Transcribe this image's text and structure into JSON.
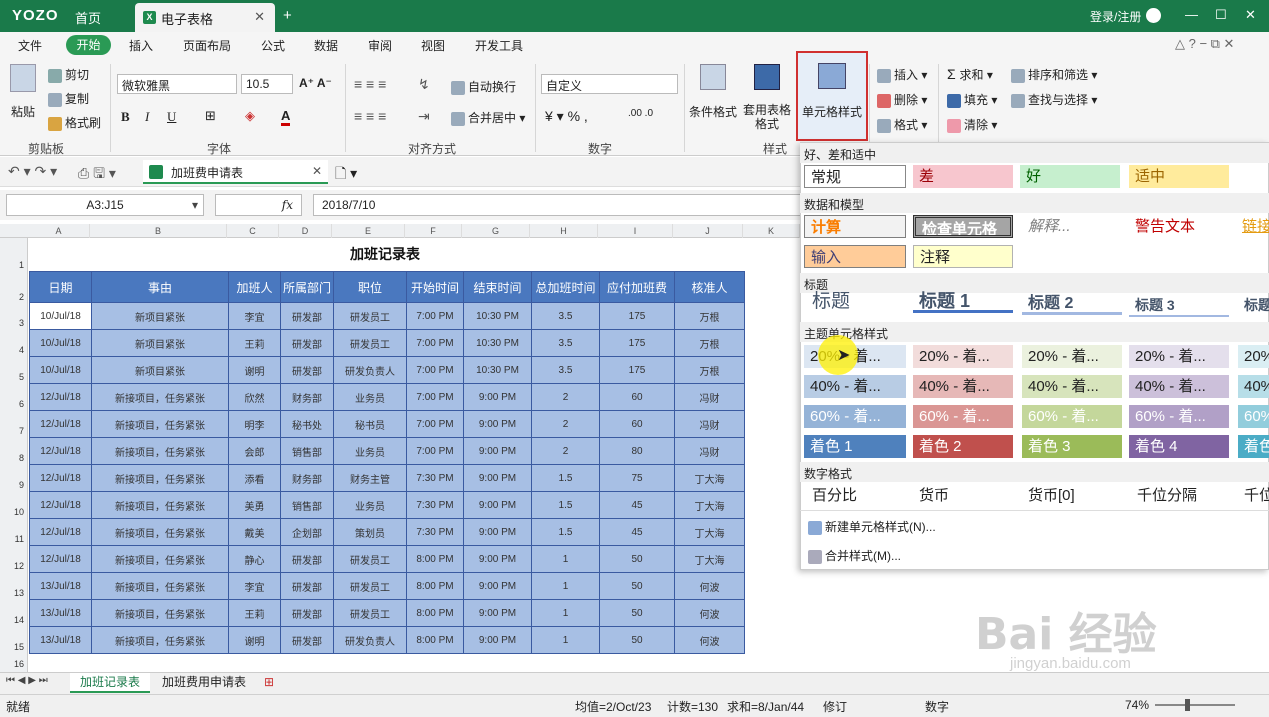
{
  "titlebar": {
    "logo": "YOZO",
    "home": "首页",
    "doc_tab": "电子表格",
    "new_tab": "+",
    "login": "登录/注册"
  },
  "menu": {
    "items": [
      "文件",
      "开始",
      "插入",
      "页面布局",
      "公式",
      "数据",
      "审阅",
      "视图",
      "开发工具"
    ]
  },
  "ribbon": {
    "clipboard": {
      "paste": "粘贴",
      "cut": "剪切",
      "copy": "复制",
      "format_painter": "格式刷",
      "group": "剪贴板"
    },
    "font": {
      "name": "微软雅黑",
      "size": "10.5",
      "group": "字体"
    },
    "align": {
      "wrap": "自动换行",
      "merge": "合并居中",
      "group": "对齐方式"
    },
    "number": {
      "format": "自定义",
      "group": "数字"
    },
    "style": {
      "conditional": "条件格式",
      "table_style": "套用表格格式",
      "cell_style": "单元格样式",
      "group": "样式"
    },
    "cells": {
      "insert": "插入",
      "delete": "删除",
      "format": "格式"
    },
    "edit": {
      "sum": "求和",
      "fill": "填充",
      "clear": "清除",
      "sort": "排序和筛选",
      "find": "查找与选择"
    }
  },
  "quickbar": {
    "file_tab": "加班费申请表"
  },
  "formula_bar": {
    "name_box": "A3:J15",
    "fx": "fx",
    "content": "2018/7/10"
  },
  "sheet": {
    "title": "加班记录表",
    "columns": [
      "A",
      "B",
      "C",
      "D",
      "E",
      "F",
      "G",
      "H",
      "I",
      "J",
      "K"
    ],
    "rows": [
      "1",
      "2",
      "3",
      "4",
      "5",
      "6",
      "7",
      "8",
      "9",
      "10",
      "11",
      "12",
      "13",
      "14",
      "15",
      "16"
    ],
    "headers": [
      "日期",
      "事由",
      "加班人",
      "所属部门",
      "职位",
      "开始时间",
      "结束时间",
      "总加班时间",
      "应付加班费",
      "核准人"
    ],
    "data": [
      [
        "10/Jul/18",
        "新项目紧张",
        "李宜",
        "研发部",
        "研发员工",
        "7:00 PM",
        "10:30 PM",
        "3.5",
        "175",
        "万根"
      ],
      [
        "10/Jul/18",
        "新项目紧张",
        "王莉",
        "研发部",
        "研发员工",
        "7:00 PM",
        "10:30 PM",
        "3.5",
        "175",
        "万根"
      ],
      [
        "10/Jul/18",
        "新项目紧张",
        "谢明",
        "研发部",
        "研发负责人",
        "7:00 PM",
        "10:30 PM",
        "3.5",
        "175",
        "万根"
      ],
      [
        "12/Jul/18",
        "新接项目，任务紧张",
        "欣然",
        "财务部",
        "业务员",
        "7:00 PM",
        "9:00 PM",
        "2",
        "60",
        "冯财"
      ],
      [
        "12/Jul/18",
        "新接项目，任务紧张",
        "明李",
        "秘书处",
        "秘书员",
        "7:00 PM",
        "9:00 PM",
        "2",
        "60",
        "冯财"
      ],
      [
        "12/Jul/18",
        "新接项目，任务紧张",
        "会郎",
        "销售部",
        "业务员",
        "7:00 PM",
        "9:00 PM",
        "2",
        "80",
        "冯财"
      ],
      [
        "12/Jul/18",
        "新接项目，任务紧张",
        "添看",
        "财务部",
        "财务主管",
        "7:30 PM",
        "9:00 PM",
        "1.5",
        "75",
        "丁大海"
      ],
      [
        "12/Jul/18",
        "新接项目，任务紧张",
        "美勇",
        "销售部",
        "业务员",
        "7:30 PM",
        "9:00 PM",
        "1.5",
        "45",
        "丁大海"
      ],
      [
        "12/Jul/18",
        "新接项目，任务紧张",
        "戴美",
        "企划部",
        "策划员",
        "7:30 PM",
        "9:00 PM",
        "1.5",
        "45",
        "丁大海"
      ],
      [
        "12/Jul/18",
        "新接项目，任务紧张",
        "静心",
        "研发部",
        "研发员工",
        "8:00 PM",
        "9:00 PM",
        "1",
        "50",
        "丁大海"
      ],
      [
        "13/Jul/18",
        "新接项目，任务紧张",
        "李宜",
        "研发部",
        "研发员工",
        "8:00 PM",
        "9:00 PM",
        "1",
        "50",
        "何波"
      ],
      [
        "13/Jul/18",
        "新接项目，任务紧张",
        "王莉",
        "研发部",
        "研发员工",
        "8:00 PM",
        "9:00 PM",
        "1",
        "50",
        "何波"
      ],
      [
        "13/Jul/18",
        "新接项目，任务紧张",
        "谢明",
        "研发部",
        "研发负责人",
        "8:00 PM",
        "9:00 PM",
        "1",
        "50",
        "何波"
      ]
    ]
  },
  "dropdown": {
    "sec1": "好、差和适中",
    "good_bad": [
      {
        "label": "常规",
        "bg": "#ffffff",
        "fg": "#222222"
      },
      {
        "label": "差",
        "bg": "#f7c6ce",
        "fg": "#9c0006"
      },
      {
        "label": "好",
        "bg": "#c6efce",
        "fg": "#006100"
      },
      {
        "label": "适中",
        "bg": "#ffeb9c",
        "fg": "#9c6500"
      }
    ],
    "sec2": "数据和模型",
    "data_model": [
      {
        "label": "计算",
        "bg": "#f2f2f2",
        "fg": "#fa7d00"
      },
      {
        "label": "检查单元格",
        "bg": "#a5a5a5",
        "fg": "#ffffff"
      },
      {
        "label": "解释...",
        "bg": "#ffffff",
        "fg": "#7f7f7f"
      },
      {
        "label": "警告文本",
        "bg": "#ffffff",
        "fg": "#c00000"
      },
      {
        "label": "链接",
        "bg": "#ffffff",
        "fg": "#e49b10"
      }
    ],
    "data_model2": [
      {
        "label": "输入",
        "bg": "#ffcc99",
        "fg": "#3f3f76"
      },
      {
        "label": "注释",
        "bg": "#ffffcc",
        "fg": "#222222"
      }
    ],
    "sec3": "标题",
    "titles": [
      "标题",
      "标题 1",
      "标题 2",
      "标题 3",
      "标题"
    ],
    "sec4": "主题单元格样式",
    "theme_row1": [
      "20% - 着...",
      "20% - 着...",
      "20% - 着...",
      "20% - 着...",
      "20%"
    ],
    "theme_row2": [
      "40% - 着...",
      "40% - 着...",
      "40% - 着...",
      "40% - 着...",
      "40%"
    ],
    "theme_row3": [
      "60% - 着...",
      "60% - 着...",
      "60% - 着...",
      "60% - 着...",
      "60%"
    ],
    "theme_row4": [
      "着色 1",
      "着色 2",
      "着色 3",
      "着色 4",
      "着色"
    ],
    "sec5": "数字格式",
    "number_formats": [
      "百分比",
      "货币",
      "货币[0]",
      "千位分隔",
      "千位"
    ],
    "new_style": "新建单元格样式(N)...",
    "merge_style": "合并样式(M)..."
  },
  "sheet_tabs": [
    "加班记录表",
    "加班费用申请表"
  ],
  "status": {
    "ready": "就绪",
    "avg": "均值=2/Oct/23",
    "count": "计数=130",
    "sum": "求和=8/Jan/44",
    "mode": "修订",
    "numlock": "数字",
    "zoom": "74%"
  },
  "watermark": {
    "logo": "Bai 经验",
    "url": "jingyan.baidu.com"
  }
}
